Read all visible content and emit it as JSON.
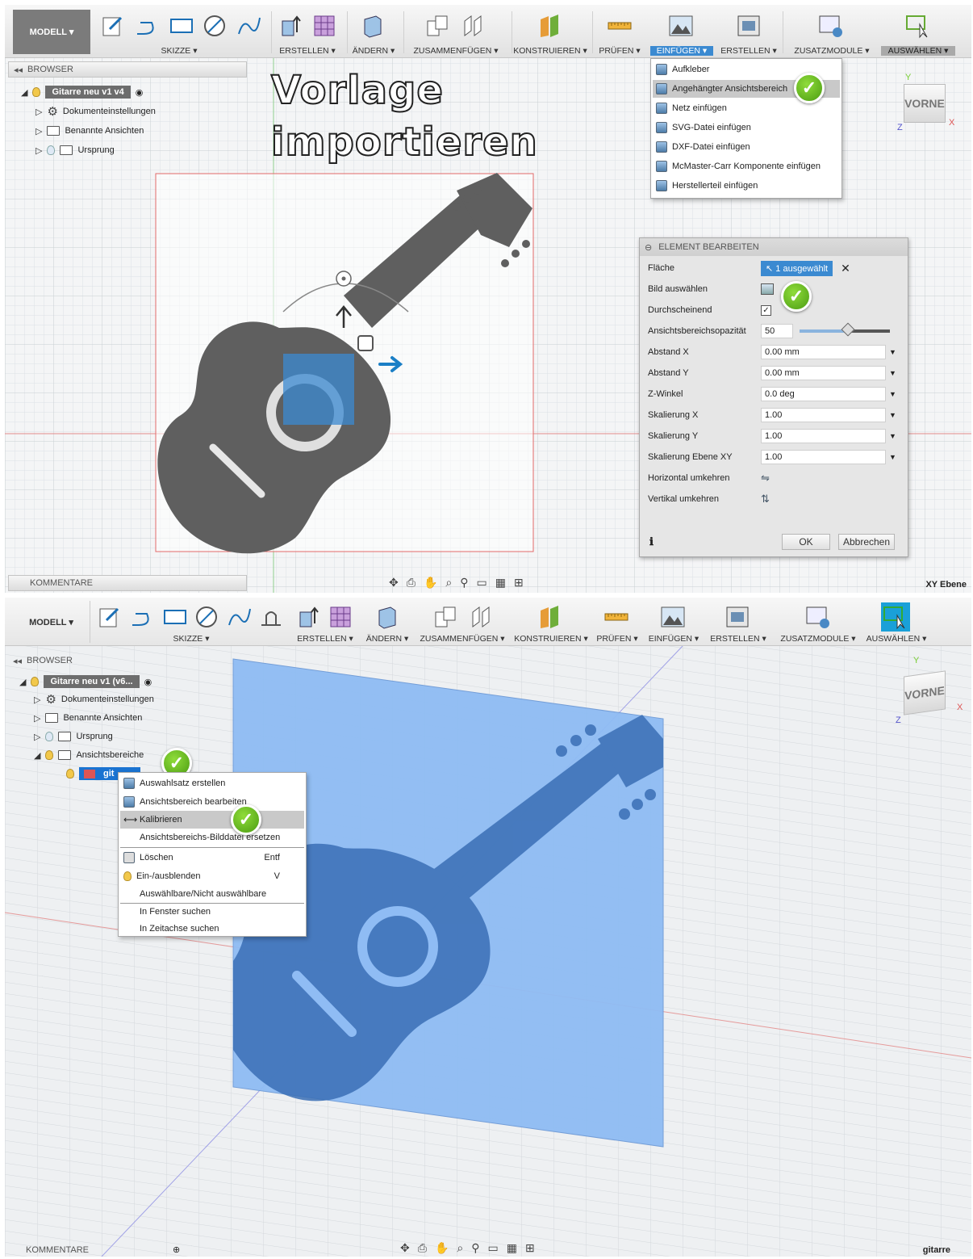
{
  "top": {
    "mode_label": "MODELL ▾",
    "groups": [
      "SKIZZE ▾",
      "ERSTELLEN ▾",
      "ÄNDERN ▾",
      "ZUSAMMENFÜGEN ▾",
      "KONSTRUIEREN ▾",
      "PRÜFEN ▾",
      "EINFÜGEN ▾",
      "ERSTELLEN ▾",
      "ZUSATZMODULE ▾",
      "AUSWÄHLEN ▾"
    ],
    "browser_label": "BROWSER",
    "tree": {
      "root": "Gitarre neu v1 v4",
      "items": [
        "Dokumenteinstellungen",
        "Benannte Ansichten",
        "Ursprung"
      ]
    },
    "overlay_title": [
      "Vorlage",
      "importieren"
    ],
    "insert_menu": [
      "Aufkleber",
      "Angehängter Ansichtsbereich",
      "Netz einfügen",
      "SVG-Datei einfügen",
      "DXF-Datei einfügen",
      "McMaster-Carr Komponente einfügen",
      "Herstellerteil einfügen"
    ],
    "dialog": {
      "title": "ELEMENT BEARBEITEN",
      "rows": {
        "flaeche": "Fläche",
        "selected": "1 ausgewählt",
        "bild": "Bild auswählen",
        "durch": "Durchscheinend",
        "opac_label": "Ansichtsbereichsopazität",
        "opac_value": "50",
        "ax_label": "Abstand X",
        "ax": "0.00 mm",
        "ay_label": "Abstand Y",
        "ay": "0.00 mm",
        "z_label": "Z-Winkel",
        "z": "0.0 deg",
        "sx_label": "Skalierung X",
        "sx": "1.00",
        "sy_label": "Skalierung Y",
        "sy": "1.00",
        "sxy_label": "Skalierung Ebene XY",
        "sxy": "1.00",
        "flip_h": "Horizontal umkehren",
        "flip_v": "Vertikal umkehren"
      },
      "ok": "OK",
      "cancel": "Abbrechen"
    },
    "viewcube": "VORNE",
    "comments": "KOMMENTARE",
    "plane": "XY Ebene"
  },
  "bottom": {
    "mode_label": "MODELL ▾",
    "groups": [
      "SKIZZE ▾",
      "ERSTELLEN ▾",
      "ÄNDERN ▾",
      "ZUSAMMENFÜGEN ▾",
      "KONSTRUIEREN ▾",
      "PRÜFEN ▾",
      "EINFÜGEN ▾",
      "ERSTELLEN ▾",
      "ZUSATZMODULE ▾",
      "AUSWÄHLEN ▾"
    ],
    "browser_label": "BROWSER",
    "tree": {
      "root": "Gitarre neu v1 (v6...",
      "items": [
        "Dokumenteinstellungen",
        "Benannte Ansichten",
        "Ursprung",
        "Ansichtsbereiche"
      ],
      "child": "git"
    },
    "context_menu": {
      "items": [
        "Auswahlsatz erstellen",
        "Ansichtsbereich bearbeiten",
        "Kalibrieren",
        "Ansichtsbereichs-Bilddatei ersetzen",
        "Löschen",
        "Ein-/ausblenden",
        "Auswählbare/Nicht auswählbare",
        "In Fenster suchen",
        "In Zeitachse suchen"
      ],
      "shortcut_delete": "Entf",
      "shortcut_toggle": "V"
    },
    "viewcube": "VORNE",
    "comments": "KOMMENTARE",
    "file_label": "gitarre"
  },
  "colors": {
    "accent": "#3b8ad1",
    "check": "#5fb51f",
    "guitar": "#5f5f5f",
    "canvas": "#90bdf5"
  }
}
